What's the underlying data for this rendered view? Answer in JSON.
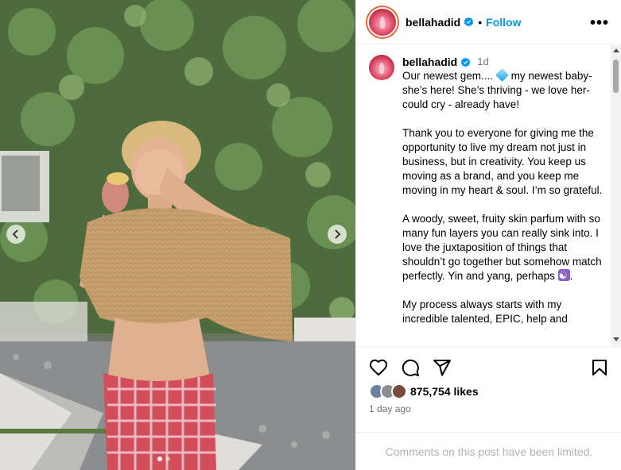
{
  "post": {
    "username": "bellahadid",
    "follow_label": "Follow",
    "separator": "•",
    "more_label": "•••",
    "time_ago": "1d",
    "likes_count": "875,754 likes",
    "posted_ago": "1 day ago",
    "comments_limited": "Comments on this post have been limited."
  },
  "caption": {
    "p1_a": "Our newest gem....",
    "p1_b": "my newest baby- she’s here! She’s thriving - we love her- could cry - already have!",
    "p2": "Thank you to everyone for giving me the opportunity to live my dream not just in business, but in creativity. You keep us moving as a brand, and you keep me moving in my heart & soul. I’m so grateful.",
    "p3": "A woody, sweet, fruity skin parfum with so many fun layers you can really sink into. I love the juxtaposition of things that shouldn’t go together but somehow match perfectly. Yin and yang, perhaps",
    "p3_end": ".",
    "p4": "My process always starts with my incredible talented, EPIC, help and"
  },
  "icons": {
    "verified": "verified-badge-icon",
    "like": "heart-icon",
    "comment": "comment-bubble-icon",
    "share": "paper-plane-icon",
    "save": "bookmark-icon",
    "prev": "chevron-left-icon",
    "next": "chevron-right-icon"
  },
  "colors": {
    "accent": "#0095f6",
    "verified": "#0095f6",
    "muted": "#737373",
    "limited": "#b2b2b2"
  },
  "carousel": {
    "slide_count": 2,
    "active_slide": 1
  }
}
